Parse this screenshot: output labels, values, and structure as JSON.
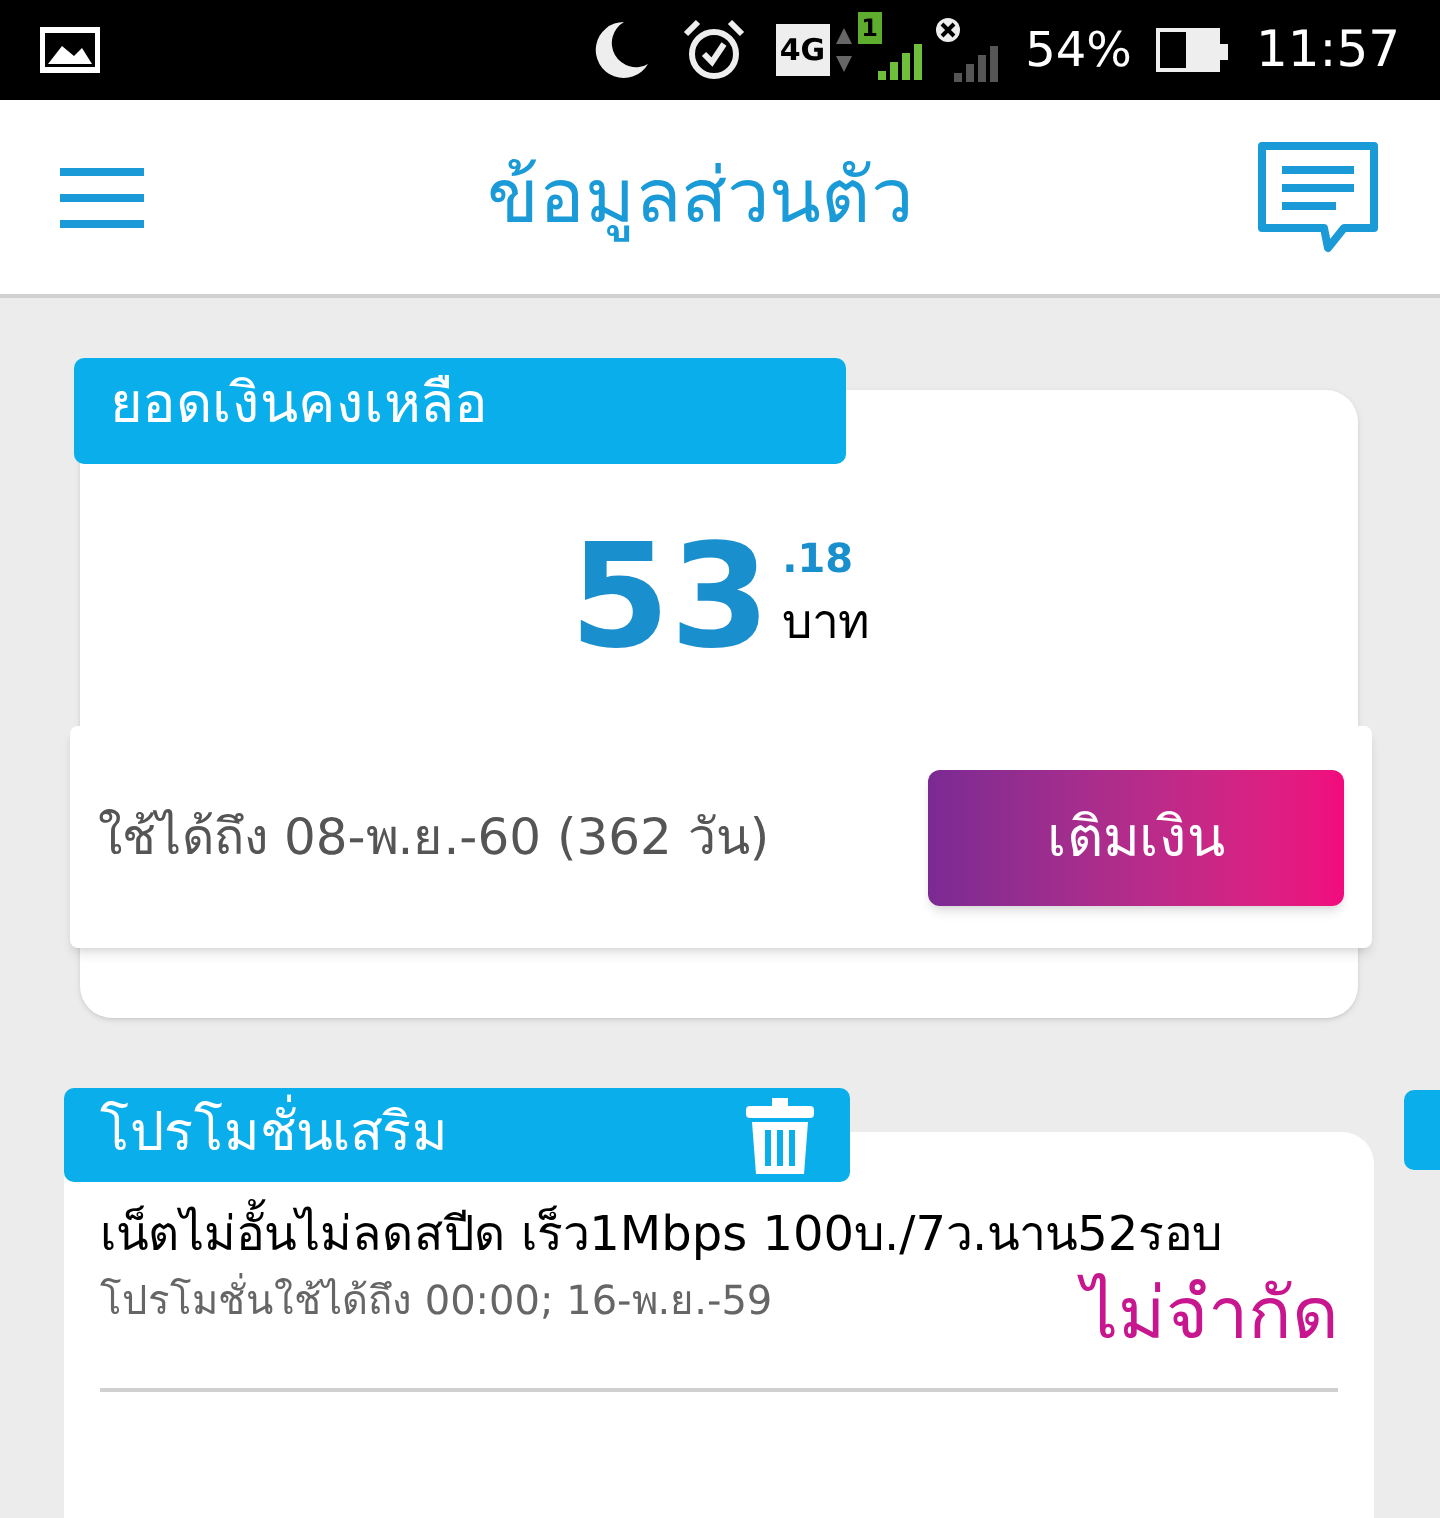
{
  "status_bar": {
    "network": "4G",
    "sim": "1",
    "battery_text": "54%",
    "time": "11:57"
  },
  "header": {
    "title": "ข้อมูลส่วนตัว"
  },
  "balance_card": {
    "tab": "ยอดเงินคงเหลือ",
    "amount": "53",
    "decimals": ".18",
    "currency": "บาท",
    "validity": "ใช้ได้ถึง 08-พ.ย.-60 (362 วัน)",
    "button": "เติมเงิน"
  },
  "promo_card": {
    "tab": "โปรโมชั่นเสริม",
    "items": [
      {
        "name": "เน็ตไม่อั้นไม่ลดสปีด เร็ว1Mbps 100บ./7ว.นาน52รอบ",
        "expiry": "โปรโมชั่นใช้ได้ถึง 00:00; 16-พ.ย.-59",
        "quota": "ไม่จำกัด"
      }
    ]
  }
}
